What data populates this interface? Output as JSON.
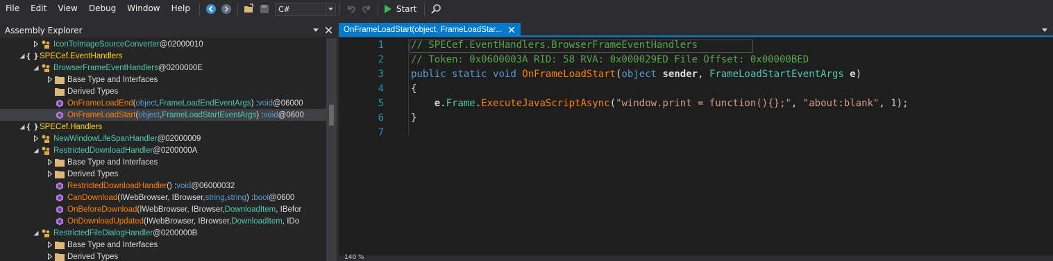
{
  "menu": [
    "File",
    "Edit",
    "View",
    "Debug",
    "Window",
    "Help"
  ],
  "toolbar": {
    "language": "C#",
    "start_label": "Start"
  },
  "explorer": {
    "title": "Assembly Explorer",
    "nodes": [
      {
        "indent": 2,
        "arrow": "right",
        "icon": "class-icon",
        "name": "IconToImageSourceConverter",
        "token": " @02000010"
      },
      {
        "indent": 1,
        "arrow": "down",
        "icon": "namespace-icon",
        "name": "SPECef.EventHandlers",
        "token": ""
      },
      {
        "indent": 2,
        "arrow": "down",
        "icon": "class-icon",
        "name": "BrowserFrameEventHandlers",
        "token": " @0200000E"
      },
      {
        "indent": 3,
        "arrow": "right",
        "icon": "folder-icon",
        "name": "Base Type and Interfaces",
        "token": ""
      },
      {
        "indent": 3,
        "arrow": "none",
        "icon": "folder-icon",
        "name": "Derived Types",
        "token": ""
      },
      {
        "indent": 3,
        "arrow": "none",
        "icon": "method-icon",
        "method": "OnFrameLoadEnd",
        "params": [
          [
            "kw",
            "object"
          ],
          [
            "p",
            ", "
          ],
          [
            "t",
            "FrameLoadEndEventArgs"
          ]
        ],
        "ret": ") : ",
        "retType": "void",
        "token": " @06000"
      },
      {
        "indent": 3,
        "arrow": "none",
        "icon": "method-icon",
        "method": "OnFrameLoadStart",
        "params": [
          [
            "kw",
            "object"
          ],
          [
            "p",
            ", "
          ],
          [
            "t",
            "FrameLoadStartEventArgs"
          ]
        ],
        "ret": ") : ",
        "retType": "void",
        "token": " @0600",
        "selected": true
      },
      {
        "indent": 1,
        "arrow": "down",
        "icon": "namespace-icon",
        "name": "SPECef.Handlers",
        "token": ""
      },
      {
        "indent": 2,
        "arrow": "right",
        "icon": "class-icon",
        "name": "NewWindowLifeSpanHandler",
        "token": " @02000009"
      },
      {
        "indent": 2,
        "arrow": "down",
        "icon": "class-icon",
        "name": "RestrictedDownloadHandler",
        "token": " @0200000A"
      },
      {
        "indent": 3,
        "arrow": "right",
        "icon": "folder-icon",
        "name": "Base Type and Interfaces",
        "token": ""
      },
      {
        "indent": 3,
        "arrow": "right",
        "icon": "folder-icon",
        "name": "Derived Types",
        "token": ""
      },
      {
        "indent": 3,
        "arrow": "none",
        "icon": "method-icon",
        "method": "RestrictedDownloadHandler",
        "params": [],
        "ret": "() : ",
        "retType": "void",
        "token": " @06000032",
        "noParen": true
      },
      {
        "indent": 3,
        "arrow": "none",
        "icon": "method-icon",
        "method": "CanDownload",
        "params": [
          [
            "p",
            "IWebBrowser, IBrowser, "
          ],
          [
            "kw",
            "string"
          ],
          [
            "p",
            ", "
          ],
          [
            "kw",
            "string"
          ]
        ],
        "ret": ") : ",
        "retType": "bool",
        "token": " @0600"
      },
      {
        "indent": 3,
        "arrow": "none",
        "icon": "method-icon",
        "method": "OnBeforeDownload",
        "params": [
          [
            "p",
            "IWebBrowser, IBrowser, "
          ],
          [
            "t",
            "DownloadItem"
          ],
          [
            "p",
            ", IBefor"
          ]
        ],
        "ret": "",
        "retType": "",
        "token": ""
      },
      {
        "indent": 3,
        "arrow": "none",
        "icon": "method-icon",
        "method": "OnDownloadUpdated",
        "params": [
          [
            "p",
            "IWebBrowser, IBrowser, "
          ],
          [
            "t",
            "DownloadItem"
          ],
          [
            "p",
            ", IDo"
          ]
        ],
        "ret": "",
        "retType": "",
        "token": ""
      },
      {
        "indent": 2,
        "arrow": "down",
        "icon": "class-icon",
        "name": "RestrictedFileDialogHandler",
        "token": " @0200000B"
      },
      {
        "indent": 3,
        "arrow": "right",
        "icon": "folder-icon",
        "name": "Base Type and Interfaces",
        "token": ""
      },
      {
        "indent": 3,
        "arrow": "right",
        "icon": "folder-icon",
        "name": "Derived Types",
        "token": ""
      }
    ]
  },
  "editor": {
    "tab_title": "OnFrameLoadStart(object, FrameLoadStar...",
    "zoom": "140 %",
    "lines": [
      {
        "n": "1",
        "parts": [
          [
            "comment",
            "// SPECef.EventHandlers.BrowserFrameEventHandlers"
          ]
        ]
      },
      {
        "n": "2",
        "parts": [
          [
            "comment",
            "// Token: 0x0600003A RID: 58 RVA: 0x000029ED File Offset: 0x00000BED"
          ]
        ]
      },
      {
        "n": "3",
        "parts": [
          [
            "kw",
            "public"
          ],
          [
            "plain",
            " "
          ],
          [
            "kw",
            "static"
          ],
          [
            "plain",
            " "
          ],
          [
            "kw",
            "void"
          ],
          [
            "plain",
            " "
          ],
          [
            "method",
            "OnFrameLoadStart"
          ],
          [
            "plain",
            "("
          ],
          [
            "kw",
            "object"
          ],
          [
            "plain",
            " "
          ],
          [
            "param",
            "sender"
          ],
          [
            "plain",
            ", "
          ],
          [
            "type",
            "FrameLoadStartEventArgs"
          ],
          [
            "plain",
            " "
          ],
          [
            "param",
            "e"
          ],
          [
            "plain",
            ")"
          ]
        ]
      },
      {
        "n": "4",
        "parts": [
          [
            "plain",
            "{"
          ]
        ]
      },
      {
        "n": "5",
        "parts": [
          [
            "plain",
            "    "
          ],
          [
            "param",
            "e"
          ],
          [
            "plain",
            "."
          ],
          [
            "prop",
            "Frame"
          ],
          [
            "plain",
            "."
          ],
          [
            "method",
            "ExecuteJavaScriptAsync"
          ],
          [
            "plain",
            "("
          ],
          [
            "str",
            "\"window.print = function(){};\""
          ],
          [
            "plain",
            ", "
          ],
          [
            "str",
            "\"about:blank\""
          ],
          [
            "plain",
            ", "
          ],
          [
            "num",
            "1"
          ],
          [
            "plain",
            ");"
          ]
        ]
      },
      {
        "n": "6",
        "parts": [
          [
            "plain",
            "}"
          ]
        ]
      },
      {
        "n": "7",
        "parts": []
      }
    ]
  }
}
